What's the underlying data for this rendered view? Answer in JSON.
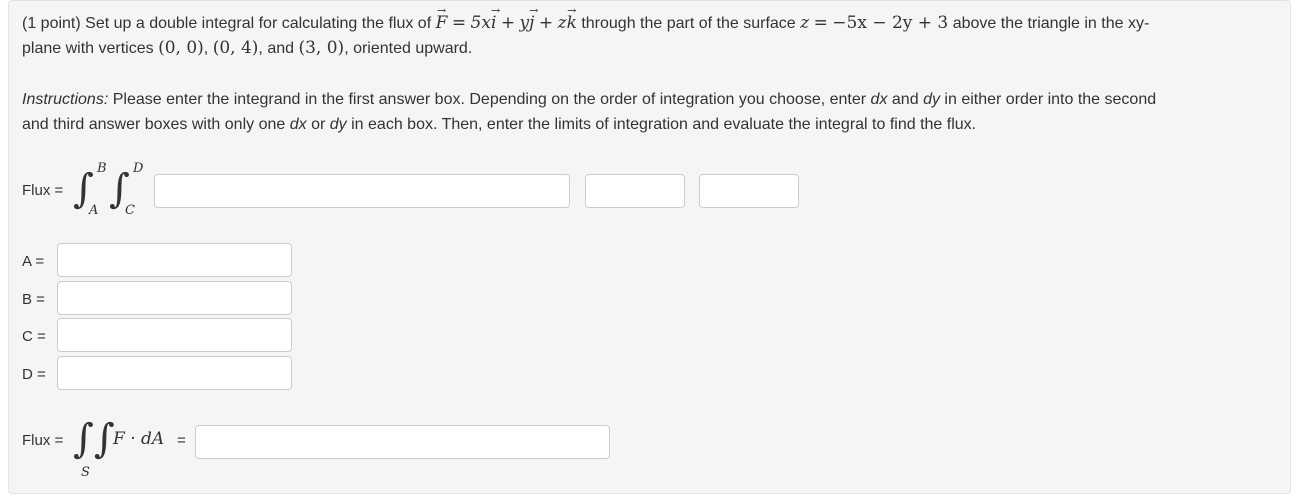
{
  "problem": {
    "point_label": "(1 point) Set up a double integral for calculating the flux of",
    "F": "F",
    "eq": "=",
    "coef_5x": "5x",
    "i": "i",
    "plus1": "+",
    "y": "y",
    "j": "j",
    "plus2": "+",
    "z": "z",
    "k": "k",
    "through_text": "through the part of the surface",
    "surface_lhs": "z",
    "surface_eq": "=",
    "surface_rhs": "−5x − 2y + 3",
    "above_text": "above the triangle in the xy-",
    "line2_text1": "plane with vertices",
    "v1": "(0, 0)",
    "comma1": ",",
    "v2": "(0, 4)",
    "and_text": ", and",
    "v3": "(3, 0)",
    "oriented_text": ", oriented upward."
  },
  "instructions": {
    "label": "Instructions:",
    "text1": "Please enter the integrand in the first answer box. Depending on the order of integration you choose, enter",
    "dx1": "dx",
    "and1": "and",
    "dy1": "dy",
    "text2": "in either order into the second",
    "line2a": "and third answer boxes with only one",
    "dx2": "dx",
    "or_text": "or",
    "dy2": "dy",
    "line2b": "in each box. Then, enter the limits of integration and evaluate the integral to find the flux."
  },
  "flux_row": {
    "label": "Flux =",
    "upper_outer": "B",
    "lower_outer": "A",
    "upper_inner": "D",
    "lower_inner": "C",
    "integrand_value": "",
    "d1_value": "",
    "d2_value": ""
  },
  "limits": [
    {
      "label": "A =",
      "value": ""
    },
    {
      "label": "B =",
      "value": ""
    },
    {
      "label": "C =",
      "value": ""
    },
    {
      "label": "D =",
      "value": ""
    }
  ],
  "flux_result": {
    "label": "Flux =",
    "surface_sub": "S",
    "integrand": "F · dA",
    "equals": "=",
    "value": ""
  }
}
